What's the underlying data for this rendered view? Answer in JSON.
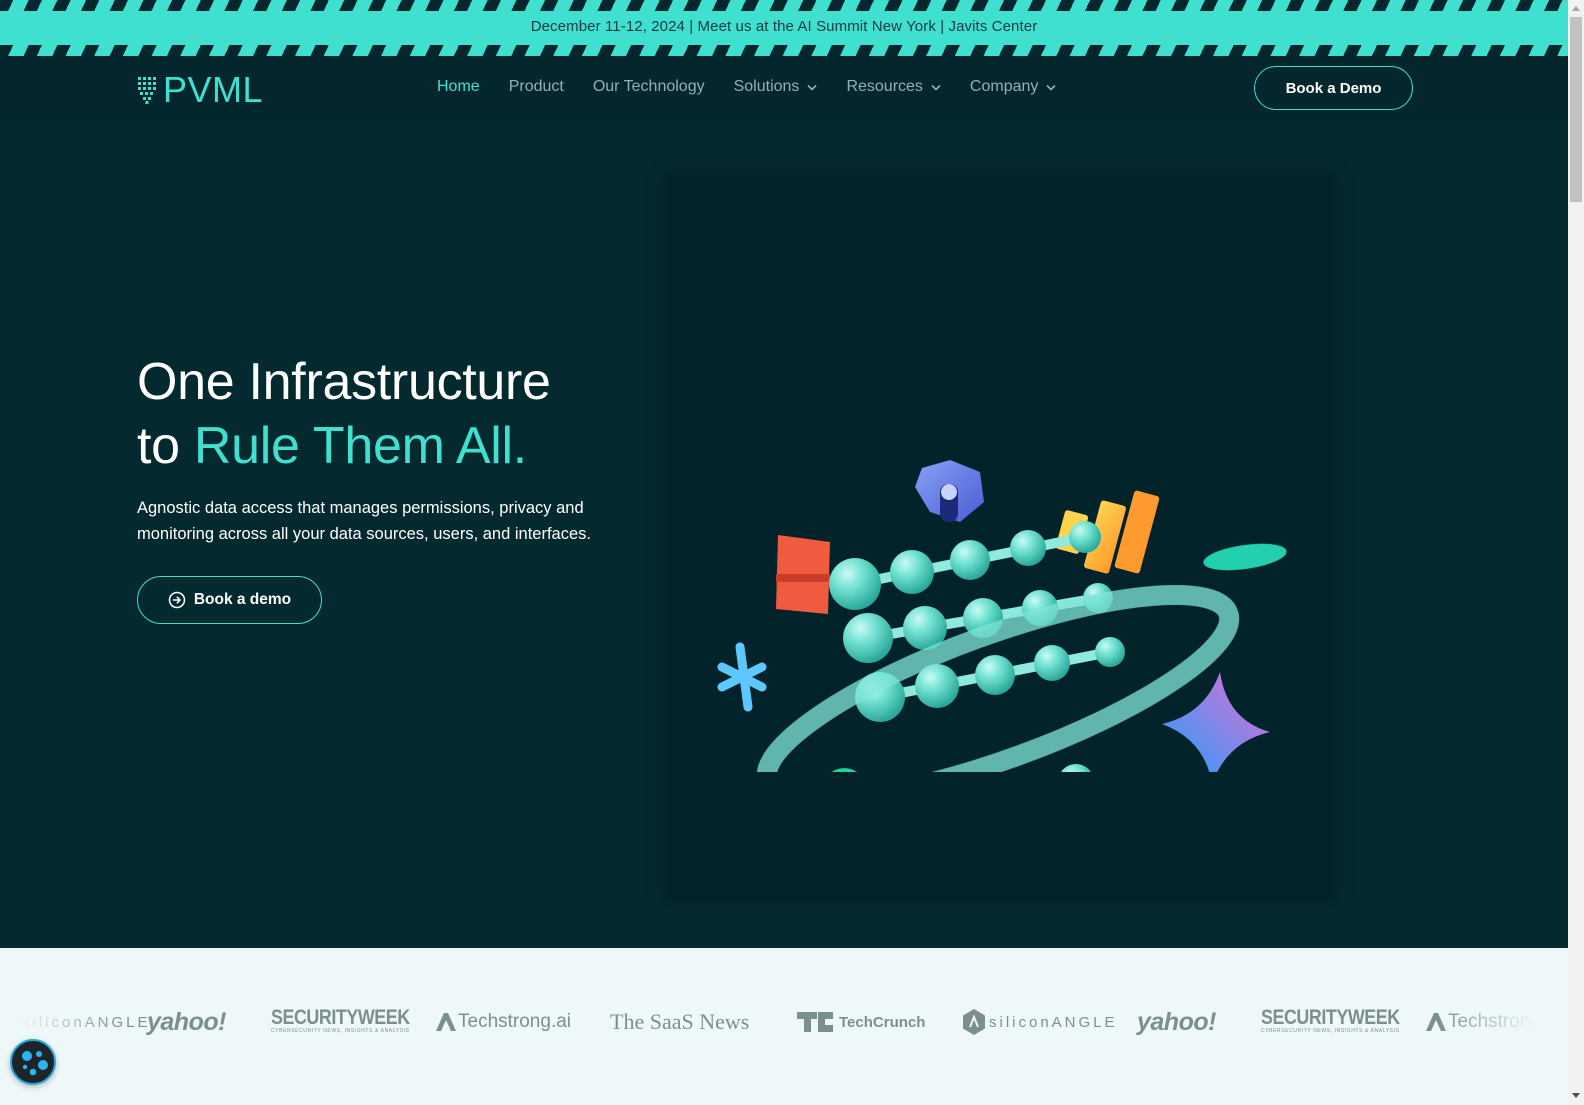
{
  "announcement": {
    "text": "December 11-12, 2024 | Meet us at the AI Summit New York | Javits Center"
  },
  "nav": {
    "logo_text": "PVML",
    "links": [
      {
        "label": "Home",
        "active": true,
        "dropdown": false
      },
      {
        "label": "Product",
        "active": false,
        "dropdown": false
      },
      {
        "label": "Our Technology",
        "active": false,
        "dropdown": false
      },
      {
        "label": "Solutions",
        "active": false,
        "dropdown": true
      },
      {
        "label": "Resources",
        "active": false,
        "dropdown": true
      },
      {
        "label": "Company",
        "active": false,
        "dropdown": true
      }
    ],
    "cta_label": "Book a Demo"
  },
  "hero": {
    "headline_line1": "One Infrastructure",
    "headline_line2_prefix": "to ",
    "headline_line2_accent": "Rule Them All.",
    "subtext": "Agnostic data access that manages permissions, privacy and monitoring across all your data sources, users, and interfaces.",
    "cta_label": "Book a demo",
    "cta_icon": "arrow-circle-right-icon",
    "illustration": "3d-data-molecules-illustration"
  },
  "press_logos": [
    "siliconANGLE",
    "yahoo!",
    "SECURITYWEEK",
    "Techstrong.ai",
    "The SaaS News",
    "TechCrunch",
    "siliconANGLE",
    "yahoo!",
    "SECURITYWEEK",
    "Techstrong"
  ],
  "press_sub": {
    "securityweek_tagline": "CYBERSECURITY NEWS, INSIGHTS & ANALYSIS"
  },
  "colors": {
    "accent": "#40e0d0",
    "background_dark": "#04272d",
    "logos_background": "#eef8f8",
    "logo_gray": "#7b8f91",
    "nav_text": "#8fb3b3"
  },
  "cookie_button": {
    "icon": "cookie-icon"
  }
}
